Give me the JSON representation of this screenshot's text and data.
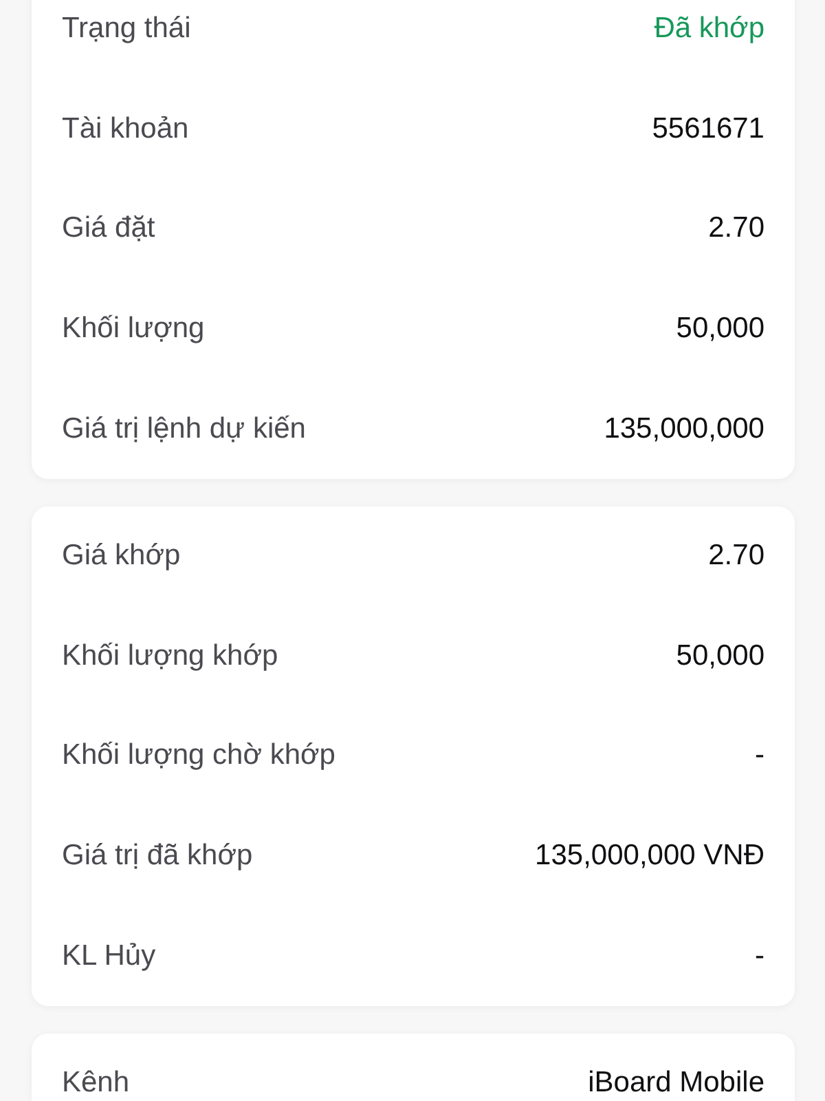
{
  "cards": [
    {
      "rows": [
        {
          "kind": "status",
          "label": "Trạng thái",
          "value": "Đã khớp"
        },
        {
          "kind": "text",
          "label": "Tài khoản",
          "value": "5561671"
        },
        {
          "kind": "text",
          "label": "Giá đặt",
          "value": "2.70"
        },
        {
          "kind": "text",
          "label": "Khối lượng",
          "value": "50,000"
        },
        {
          "kind": "text",
          "label": "Giá trị lệnh dự kiến",
          "value": "135,000,000"
        }
      ]
    },
    {
      "rows": [
        {
          "kind": "text",
          "label": "Giá khớp",
          "value": "2.70"
        },
        {
          "kind": "text",
          "label": "Khối lượng khớp",
          "value": "50,000"
        },
        {
          "kind": "text",
          "label": "Khối lượng chờ khớp",
          "value": "-"
        },
        {
          "kind": "text",
          "label": "Giá trị đã khớp",
          "value": "135,000,000 VNĐ"
        },
        {
          "kind": "text",
          "label": "KL Hủy",
          "value": "-"
        }
      ]
    },
    {
      "rows": [
        {
          "kind": "text",
          "label": "Kênh",
          "value": "iBoard Mobile"
        }
      ]
    }
  ]
}
